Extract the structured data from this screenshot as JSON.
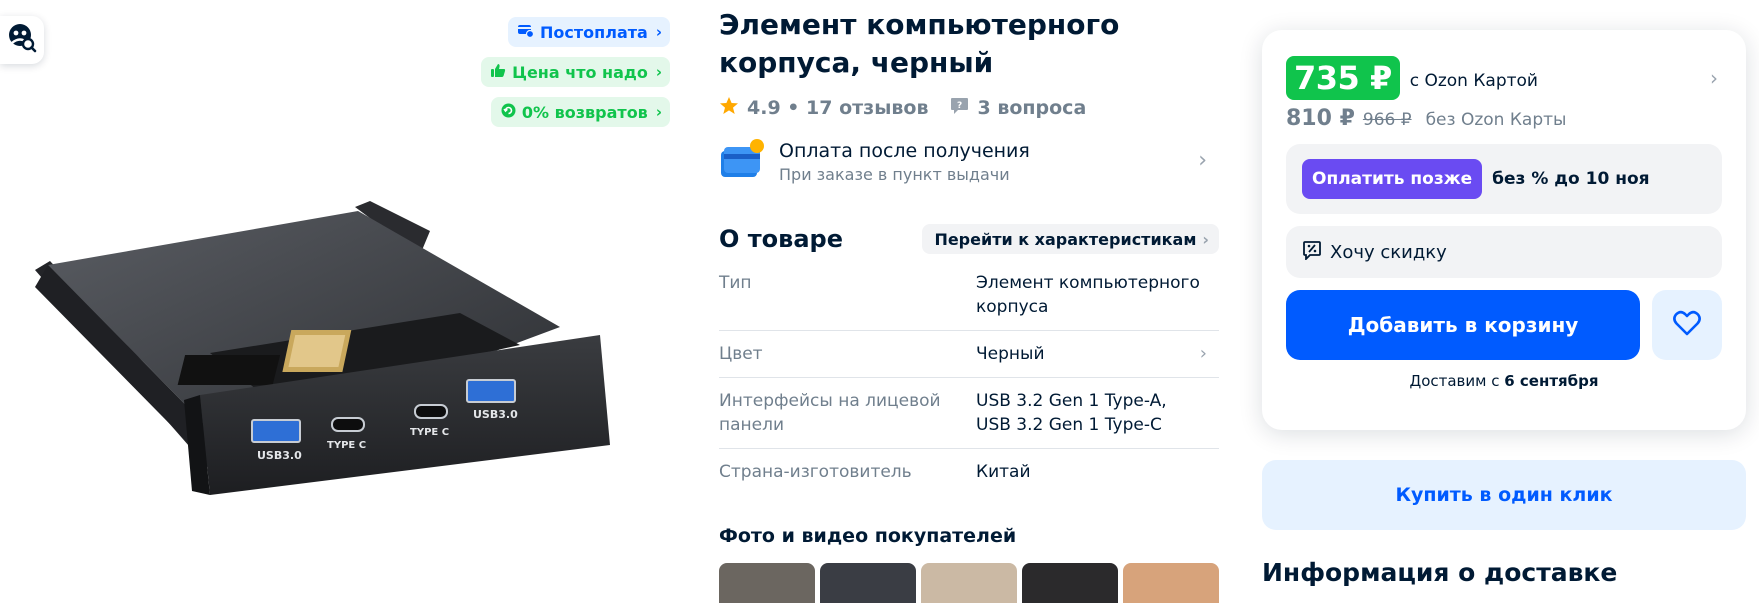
{
  "badges": [
    {
      "label": "Постоплата",
      "icon": "car-card-icon"
    },
    {
      "label": "Цена что надо",
      "icon": "thumbs-up-icon"
    },
    {
      "label": "0% возвратов",
      "icon": "return-icon"
    }
  ],
  "product": {
    "title": "Элемент компьютерного корпуса, черный",
    "rating": "4.9 • 17 отзывов",
    "questions": "3 вопроса",
    "photo_labels": [
      "USB3.0",
      "TYPE C",
      "TYPE C",
      "USB3.0"
    ]
  },
  "payment": {
    "title": "Оплата после получения",
    "subtitle": "При заказе в пункт выдачи"
  },
  "about": {
    "title": "О товаре",
    "to_specs": "Перейти к характеристикам",
    "specs": [
      {
        "key": "Тип",
        "value": "Элемент компьютерного корпуса"
      },
      {
        "key": "Цвет",
        "value": "Черный"
      },
      {
        "key": "Интерфейсы на лицевой панели",
        "value": "USB 3.2 Gen 1 Type-A, USB 3.2 Gen 1 Type-C"
      },
      {
        "key": "Страна-изготовитель",
        "value": "Китай"
      }
    ]
  },
  "ugc": {
    "title": "Фото и видео покупателей",
    "thumb_colors": [
      "#6b6660",
      "#3a3d44",
      "#cbb9a4",
      "#2b2a2c",
      "#d7a37b"
    ]
  },
  "buy": {
    "price_ozon_card": "735 ₽",
    "price_ozon_card_label": "с Ozon Картой",
    "price_regular": "810 ₽",
    "price_old": "966 ₽",
    "price_regular_label": "без Ozon Карты",
    "pay_later_button": "Оплатить позже",
    "pay_later_text": "без % до 10 ноя",
    "want_discount": "Хочу скидку",
    "add_to_cart": "Добавить в корзину",
    "delivery_prefix": "Доставим с",
    "delivery_date": "6 сентября",
    "buy_one_click": "Купить в один клик",
    "delivery_info_title": "Информация о доставке"
  },
  "colors": {
    "brand_blue": "#005bff",
    "ozon_green": "#10c44c",
    "pay_later_purple": "#6a4bf2"
  }
}
